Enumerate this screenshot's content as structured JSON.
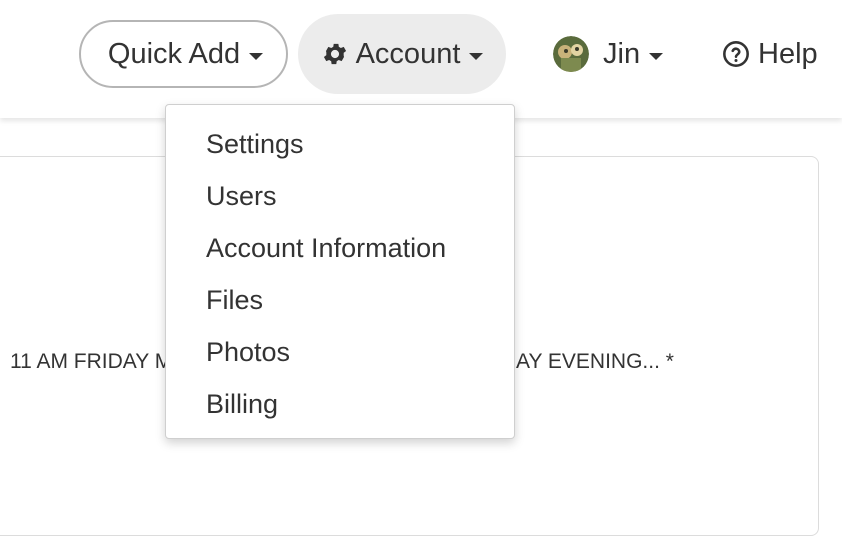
{
  "nav": {
    "quick_add": "Quick Add",
    "account": "Account",
    "user": "Jin",
    "help": "Help"
  },
  "account_menu": {
    "items": [
      "Settings",
      "Users",
      "Account Information",
      "Files",
      "Photos",
      "Billing"
    ]
  },
  "background": {
    "text_left": "11 AM FRIDAY M",
    "text_right": "AY EVENING... *"
  },
  "colors": {
    "text": "#333333",
    "account_active_bg": "#ececec",
    "pill_border": "#b5b5b5",
    "menu_border": "#cfcfcf"
  },
  "icons": {
    "account": "gear-icon",
    "user": "avatar-image",
    "help": "question-circle-icon",
    "dropdown": "caret-down-icon"
  }
}
